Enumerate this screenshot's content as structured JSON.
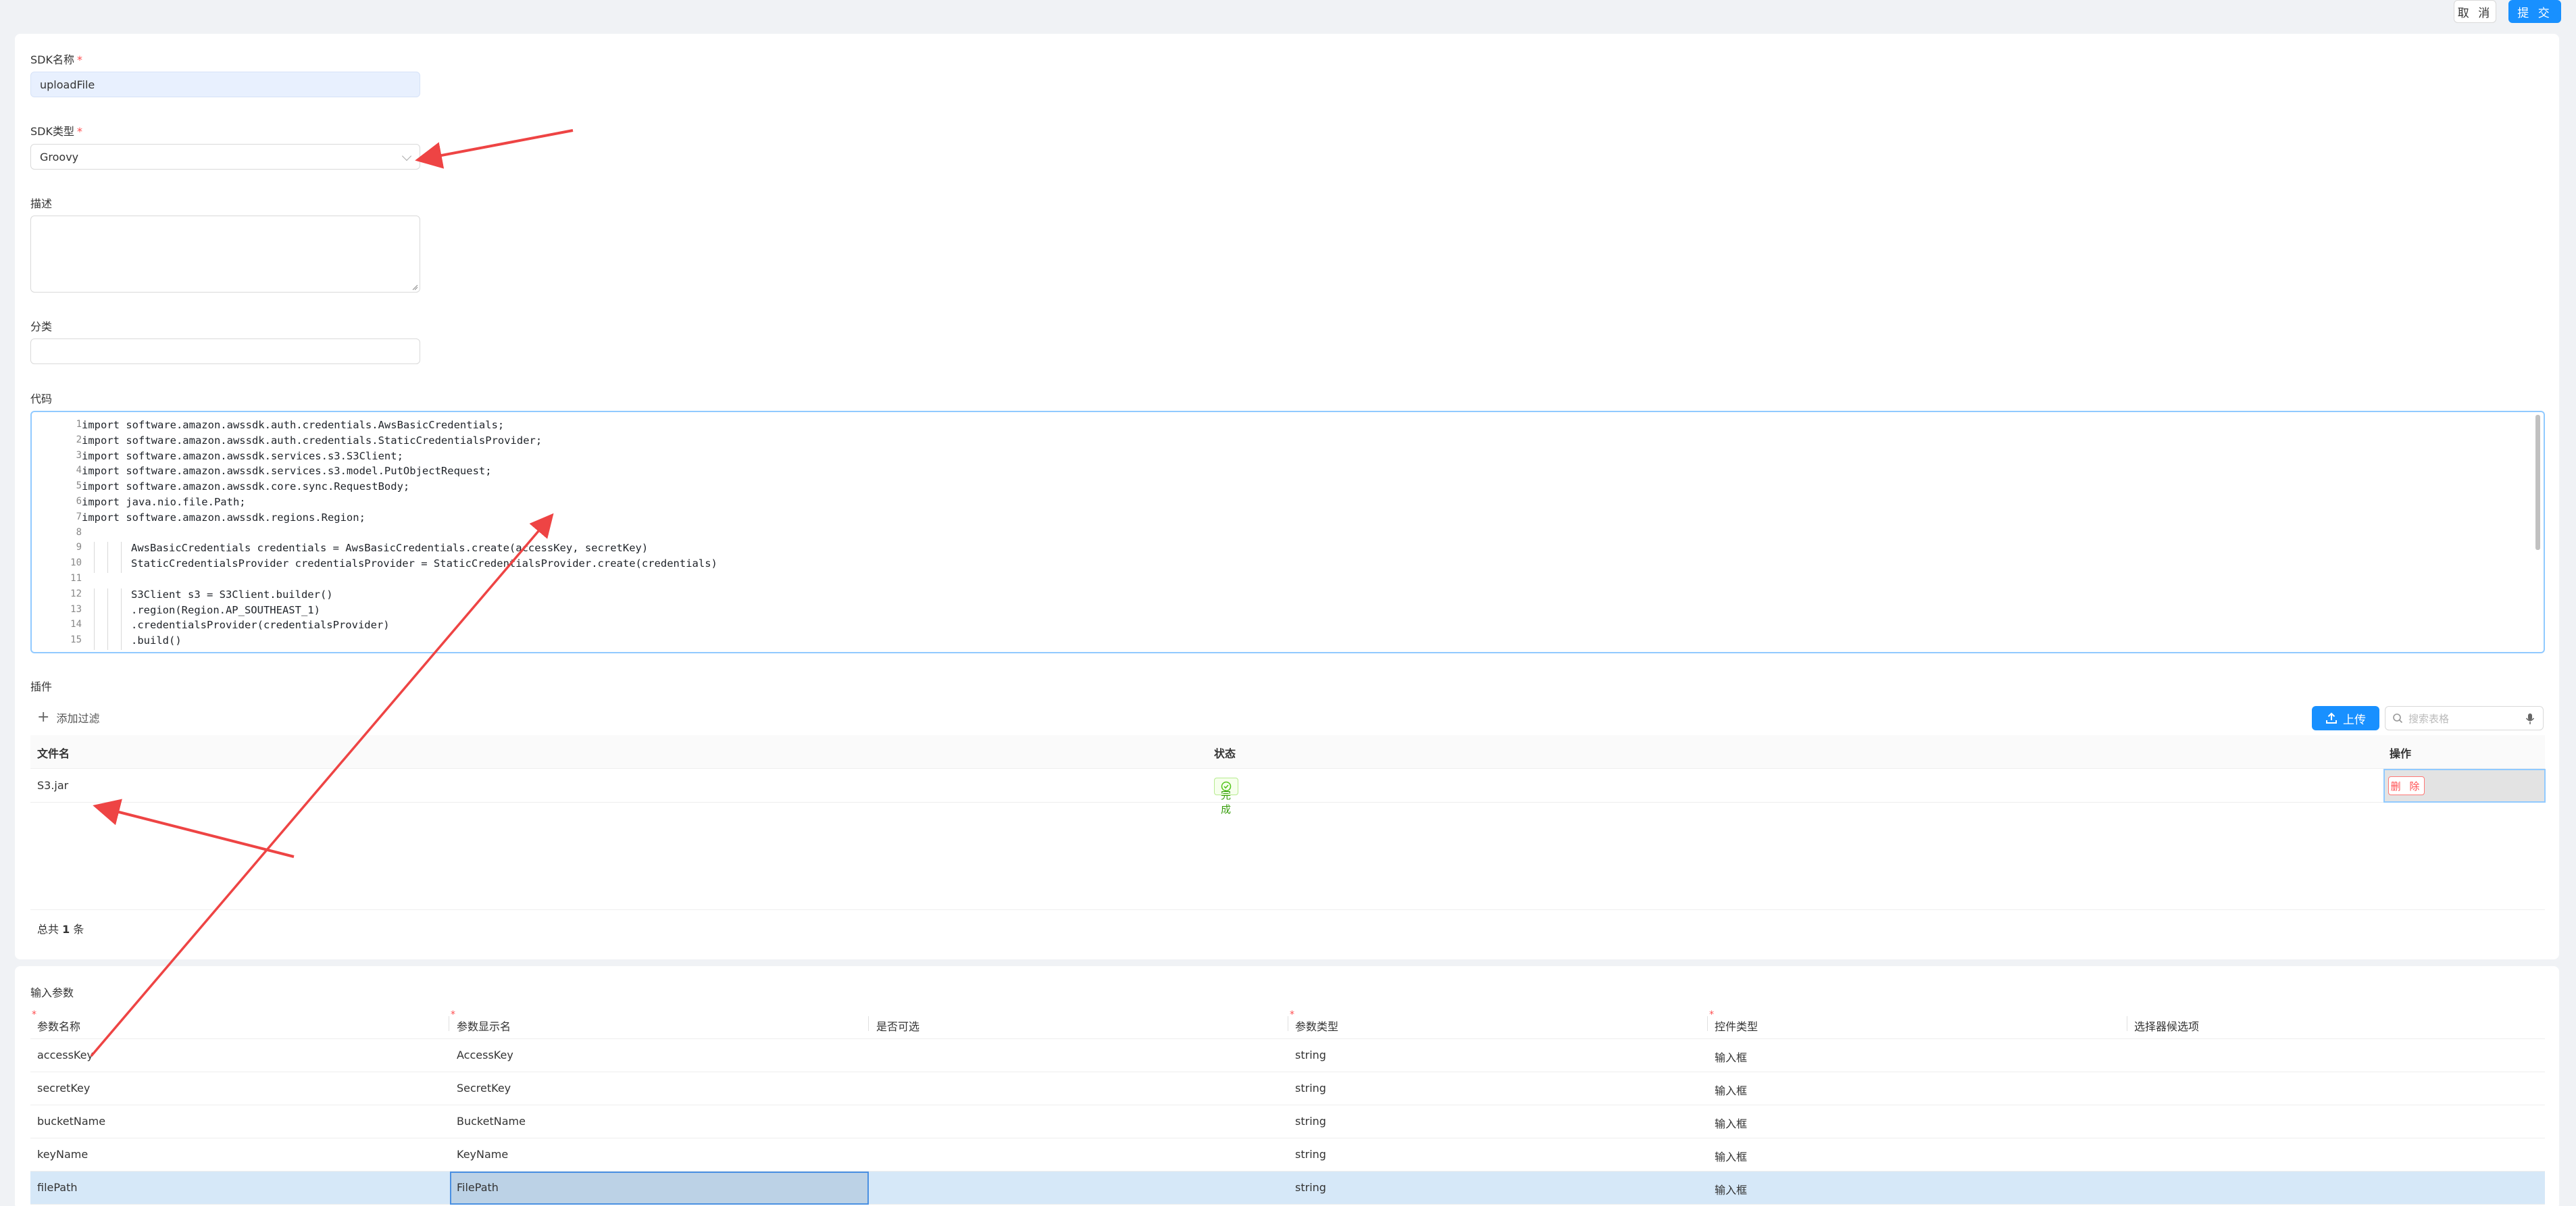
{
  "header": {
    "cancel_label": "取 消",
    "submit_label": "提 交"
  },
  "form": {
    "sdk_name": {
      "label": "SDK名称",
      "required_mark": "*",
      "value": "uploadFile"
    },
    "sdk_type": {
      "label": "SDK类型",
      "required_mark": "*",
      "value": "Groovy"
    },
    "description": {
      "label": "描述",
      "value": ""
    },
    "category": {
      "label": "分类",
      "value": ""
    },
    "code": {
      "label": "代码",
      "lines": [
        {
          "n": "1",
          "indent": 0,
          "text": "import software.amazon.awssdk.auth.credentials.AwsBasicCredentials;"
        },
        {
          "n": "2",
          "indent": 0,
          "text": "import software.amazon.awssdk.auth.credentials.StaticCredentialsProvider;"
        },
        {
          "n": "3",
          "indent": 0,
          "text": "import software.amazon.awssdk.services.s3.S3Client;"
        },
        {
          "n": "4",
          "indent": 0,
          "text": "import software.amazon.awssdk.services.s3.model.PutObjectRequest;"
        },
        {
          "n": "5",
          "indent": 0,
          "text": "import software.amazon.awssdk.core.sync.RequestBody;"
        },
        {
          "n": "6",
          "indent": 0,
          "text": "import java.nio.file.Path;"
        },
        {
          "n": "7",
          "indent": 0,
          "text": "import software.amazon.awssdk.regions.Region;"
        },
        {
          "n": "8",
          "indent": 0,
          "text": ""
        },
        {
          "n": "9",
          "indent": 1,
          "text": "AwsBasicCredentials credentials = AwsBasicCredentials.create(accessKey, secretKey)"
        },
        {
          "n": "10",
          "indent": 1,
          "text": "StaticCredentialsProvider credentialsProvider = StaticCredentialsProvider.create(credentials)"
        },
        {
          "n": "11",
          "indent": 0,
          "text": ""
        },
        {
          "n": "12",
          "indent": 1,
          "text": "S3Client s3 = S3Client.builder()"
        },
        {
          "n": "13",
          "indent": 1,
          "text": ".region(Region.AP_SOUTHEAST_1)"
        },
        {
          "n": "14",
          "indent": 1,
          "text": ".credentialsProvider(credentialsProvider)"
        },
        {
          "n": "15",
          "indent": 1,
          "text": ".build()"
        }
      ]
    }
  },
  "plugins": {
    "label": "插件",
    "add_filter_label": "添加过滤",
    "upload_label": "上传",
    "search_placeholder": "搜索表格",
    "columns": {
      "file_name": "文件名",
      "status": "状态",
      "actions": "操作"
    },
    "rows": [
      {
        "file_name": "S3.jar",
        "status": "完成",
        "delete_label": "删 除"
      }
    ],
    "total_prefix": "总共",
    "total_count": "1",
    "total_suffix": "条"
  },
  "input_params": {
    "label": "输入参数",
    "required_mark": "*",
    "columns": {
      "name": "参数名称",
      "display_name": "参数显示名",
      "optional": "是否可选",
      "type": "参数类型",
      "control": "控件类型",
      "options": "选择器候选项"
    },
    "rows": [
      {
        "name": "accessKey",
        "display_name": "AccessKey",
        "type": "string",
        "control": "输入框"
      },
      {
        "name": "secretKey",
        "display_name": "SecretKey",
        "type": "string",
        "control": "输入框"
      },
      {
        "name": "bucketName",
        "display_name": "BucketName",
        "type": "string",
        "control": "输入框"
      },
      {
        "name": "keyName",
        "display_name": "KeyName",
        "type": "string",
        "control": "输入框"
      },
      {
        "name": "filePath",
        "display_name": "FilePath",
        "type": "string",
        "control": "输入框"
      }
    ]
  },
  "annotation_color": "#ee4444",
  "accent_color": "#1890ff"
}
